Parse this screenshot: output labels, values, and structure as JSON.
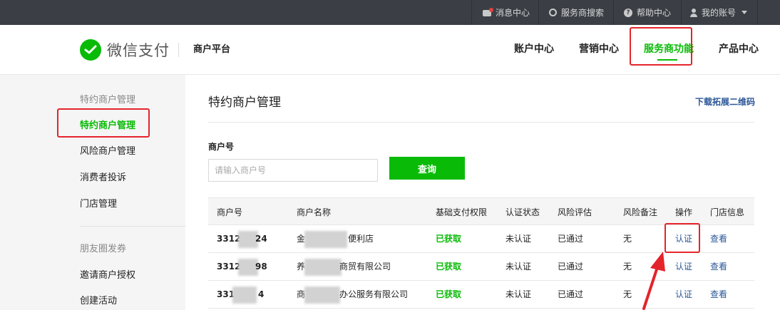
{
  "topbar": {
    "items": [
      {
        "label": "消息中心",
        "icon": "message-icon"
      },
      {
        "label": "服务商搜索",
        "icon": "search-icon"
      },
      {
        "label": "帮助中心",
        "icon": "help-icon"
      },
      {
        "label": "我的账号",
        "icon": "user-icon"
      }
    ]
  },
  "header": {
    "logo_text": "微信支付",
    "platform": "商户平台",
    "nav": [
      {
        "label": "账户中心"
      },
      {
        "label": "营销中心"
      },
      {
        "label": "服务商功能",
        "active": true
      },
      {
        "label": "产品中心"
      }
    ]
  },
  "sidebar": {
    "section1_title": "特约商户管理",
    "items1": [
      "特约商户管理",
      "风险商户管理",
      "消费者投诉",
      "门店管理"
    ],
    "section2_title": "朋友圈发券",
    "items2": [
      "邀请商户授权",
      "创建活动"
    ]
  },
  "main": {
    "title": "特约商户管理",
    "download_link": "下载拓展二维码",
    "field_label": "商户号",
    "search_placeholder": "请输入商户号",
    "query_button": "查询"
  },
  "table": {
    "headers": [
      "商户号",
      "商户名称",
      "基础支付权限",
      "认证状态",
      "风险评估",
      "风险备注",
      "操作",
      "门店信息"
    ],
    "rows": [
      {
        "id_prefix": "3312",
        "id_suffix": "24",
        "name_prefix": "金",
        "name_suffix": "便利店",
        "perm": "已获取",
        "auth": "未认证",
        "risk": "已通过",
        "note": "无",
        "op": "认证",
        "store": "查看"
      },
      {
        "id_prefix": "3312",
        "id_suffix": "98",
        "name_prefix": "养",
        "name_suffix": "商贸有限公司",
        "perm": "已获取",
        "auth": "未认证",
        "risk": "已通过",
        "note": "无",
        "op": "认证",
        "store": "查看"
      },
      {
        "id_prefix": "331",
        "id_suffix": "4",
        "name_prefix": "商",
        "name_suffix": "办公服务有限公司",
        "perm": "已获取",
        "auth": "未认证",
        "risk": "已通过",
        "note": "无",
        "op": "认证",
        "store": "查看"
      }
    ]
  },
  "colors": {
    "brand_green": "#09bb07",
    "link_blue": "#2b5797",
    "highlight_red": "#e4242b",
    "topbar_bg": "#3b3f45"
  }
}
